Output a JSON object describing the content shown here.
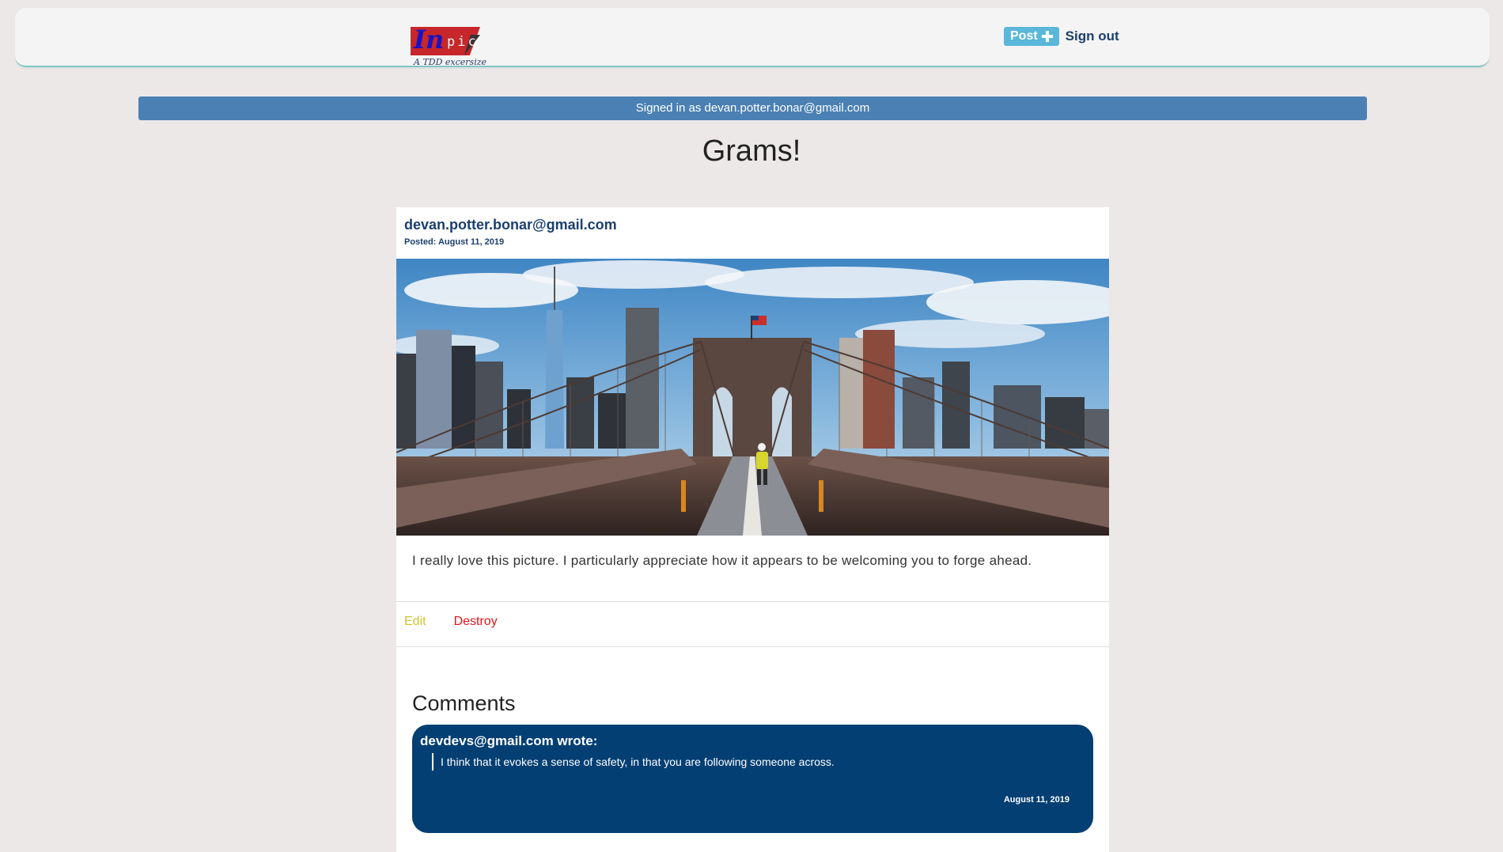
{
  "navbar": {
    "logo_in": "In",
    "logo_pic": "pic",
    "logo_tagline": "A TDD excersize",
    "post_label": "Post",
    "signout_label": "Sign out"
  },
  "alert": {
    "text": "Signed in as devan.potter.bonar@gmail.com"
  },
  "page": {
    "title": "Grams!"
  },
  "post": {
    "author": "devan.potter.bonar@gmail.com",
    "posted_date": "Posted: August 11, 2019",
    "caption": "I really love this picture. I particularly appreciate how it appears to be welcoming you to forge ahead.",
    "edit_label": "Edit",
    "destroy_label": "Destroy"
  },
  "comments": {
    "heading": "Comments",
    "items": [
      {
        "author_line": "devdevs@gmail.com wrote:",
        "body": "I think that it evokes a sense of safety, in that you are following someone across.",
        "date": "August 11, 2019"
      }
    ]
  },
  "colors": {
    "background": "#ece8e8",
    "alert": "#4a80b4",
    "comment_bg": "#033f73",
    "link_navy": "#1a3f6e",
    "edit": "#d0c430",
    "destroy": "#e0161c",
    "post_button": "#5ab7d9"
  }
}
